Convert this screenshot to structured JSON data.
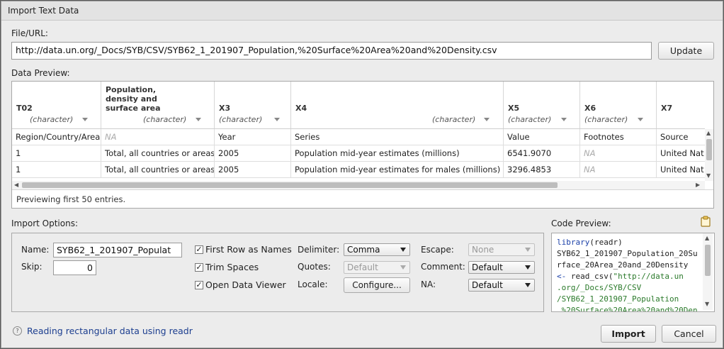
{
  "window": {
    "title": "Import Text Data"
  },
  "file": {
    "label": "File/URL:",
    "url": "http://data.un.org/_Docs/SYB/CSV/SYB62_1_201907_Population,%20Surface%20Area%20and%20Density.csv",
    "update_label": "Update"
  },
  "preview": {
    "label": "Data Preview:",
    "columns": [
      {
        "name": "T02",
        "type": "(character)"
      },
      {
        "name": "Population, density and surface area",
        "type": "(character)"
      },
      {
        "name": "X3",
        "type": "(character)"
      },
      {
        "name": "X4",
        "type": "(character)"
      },
      {
        "name": "X5",
        "type": "(character)"
      },
      {
        "name": "X6",
        "type": "(character)"
      },
      {
        "name": "X7",
        "type": ""
      }
    ],
    "rows": [
      [
        "Region/Country/Area",
        "NA",
        "Year",
        "Series",
        "Value",
        "Footnotes",
        "Source"
      ],
      [
        "1",
        "Total, all countries or areas",
        "2005",
        "Population mid-year estimates (millions)",
        "6541.9070",
        "NA",
        "United Nat"
      ],
      [
        "1",
        "Total, all countries or areas",
        "2005",
        "Population mid-year estimates for males (millions)",
        "3296.4853",
        "NA",
        "United Nat"
      ]
    ],
    "footer": "Previewing first 50 entries."
  },
  "options": {
    "label": "Import Options:",
    "name_label": "Name:",
    "name_value": "SYB62_1_201907_Populat",
    "skip_label": "Skip:",
    "skip_value": "0",
    "first_row_label": "First Row as Names",
    "trim_label": "Trim Spaces",
    "open_viewer_label": "Open Data Viewer",
    "delimiter_label": "Delimiter:",
    "delimiter_value": "Comma",
    "quotes_label": "Quotes:",
    "quotes_value": "Default",
    "locale_label": "Locale:",
    "configure_label": "Configure...",
    "escape_label": "Escape:",
    "escape_value": "None",
    "comment_label": "Comment:",
    "comment_value": "Default",
    "na_label": "NA:",
    "na_value": "Default"
  },
  "code": {
    "label": "Code Preview:",
    "line1_kw": "library",
    "line1_rest": "(readr)",
    "line2": "SYB62_1_201907_Population_20Su",
    "line3": "rface_20Area_20and_20Density",
    "line4_op": "<- ",
    "line4_fn": "read_csv(",
    "line4_str": "\"http://data.un",
    "line5": ".org/_Docs/SYB/CSV",
    "line6": "/SYB62_1_201907_Population",
    "line7": ",%20Surface%20Area%20and%20Den"
  },
  "footer": {
    "help_link": "Reading rectangular data using readr",
    "import_label": "Import",
    "cancel_label": "Cancel"
  }
}
